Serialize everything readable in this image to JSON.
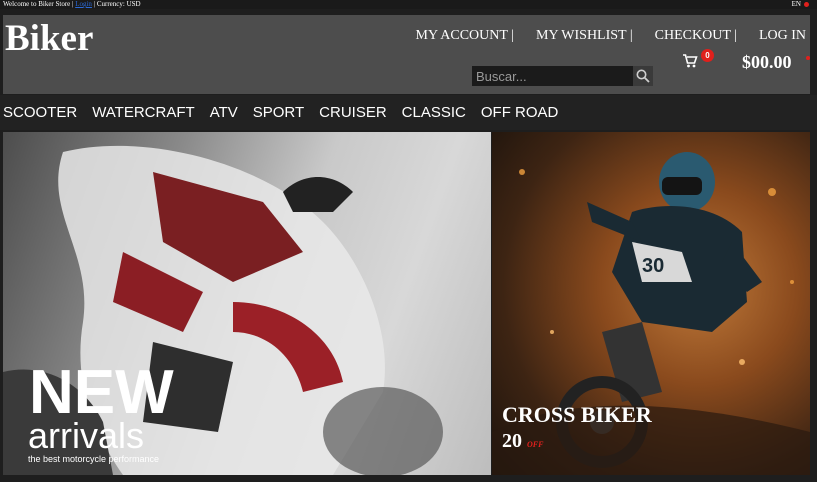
{
  "topbar": {
    "welcome": "Welcome to Biker Store |",
    "login_link": "Login",
    "currency": "| Currency: USD",
    "language": "EN"
  },
  "header": {
    "logo": "Biker",
    "nav": [
      "MY ACCOUNT |",
      "MY WISHLIST |",
      "CHECKOUT |",
      "LOG IN"
    ],
    "search_placeholder": "Buscar...",
    "cart_count": "0",
    "cart_total": "$00.00"
  },
  "categories": [
    "SCOOTER",
    "WATERCRAFT",
    "ATV",
    "SPORT",
    "CRUISER",
    "CLASSIC",
    "OFF ROAD"
  ],
  "hero_left": {
    "title": "NEW",
    "subtitle": "arrivals",
    "tagline": "the best motorcycle performance"
  },
  "hero_right": {
    "title": "CROSS BIKER",
    "discount": "20",
    "off_label": "OFF"
  },
  "colors": {
    "accent": "#e0201c",
    "header_bg": "#4d4d4d",
    "nav_bg": "#222222"
  }
}
